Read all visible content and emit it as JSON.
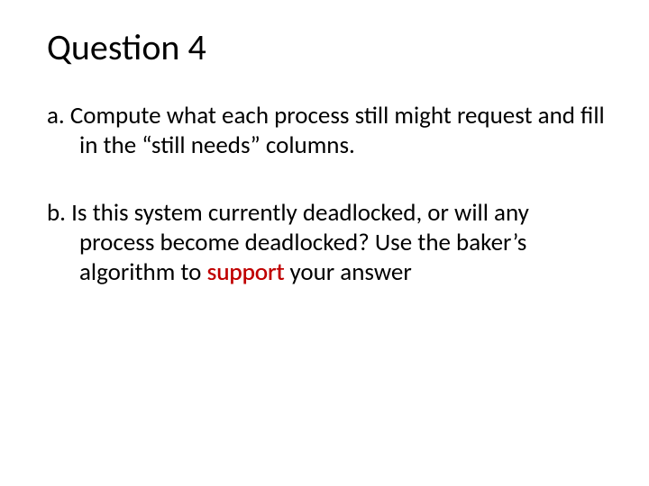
{
  "title": "Question 4",
  "items": [
    {
      "label": "a.",
      "text_before": " Compute what each process still might request and fill in the “still needs” columns.",
      "highlight": "",
      "text_after": ""
    },
    {
      "label": "b.",
      "text_before": " Is this system currently deadlocked, or will any process become deadlocked? Use the baker’s algorithm to ",
      "highlight": "support",
      "text_after": " your answer"
    }
  ]
}
